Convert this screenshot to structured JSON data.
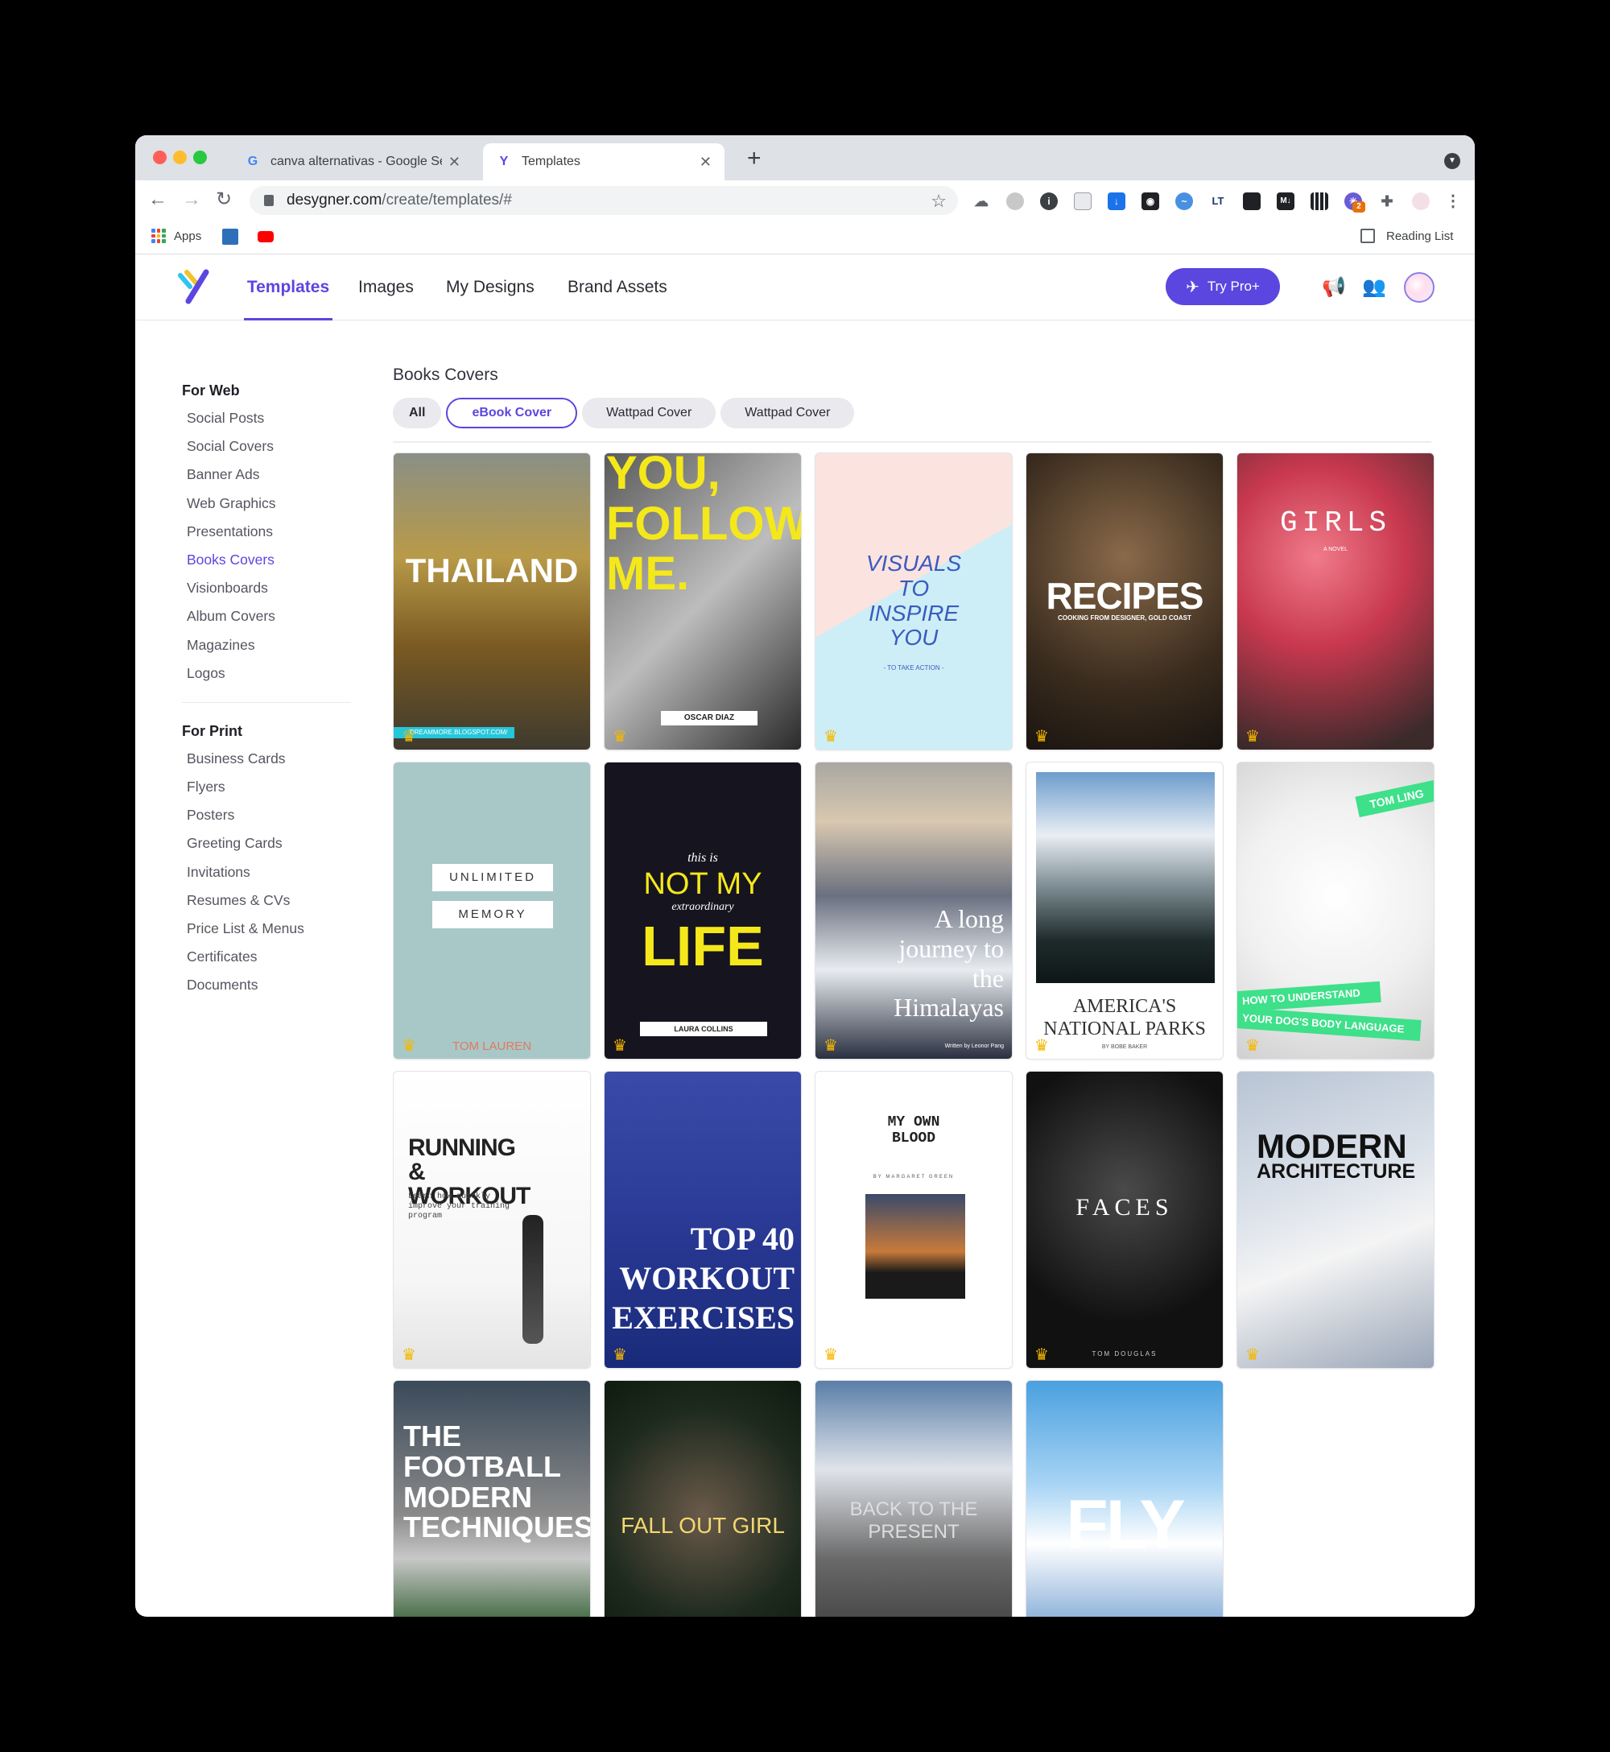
{
  "browser": {
    "tabs": [
      {
        "title": "canva alternativas - Google Se",
        "favicon": "google-icon"
      },
      {
        "title": "Templates",
        "favicon": "desygner-icon"
      }
    ],
    "url_domain": "desygner.com",
    "url_path": "/create/templates/#",
    "bookmarks": {
      "apps_label": "Apps",
      "reading_list_label": "Reading List"
    },
    "extension_badge": "2"
  },
  "app": {
    "nav": [
      "Templates",
      "Images",
      "My Designs",
      "Brand Assets"
    ],
    "active_nav": "Templates",
    "try_pro_label": "Try Pro+",
    "accent": "#5b46e0"
  },
  "sidebar": {
    "web_heading": "For Web",
    "web_items": [
      "Social Posts",
      "Social Covers",
      "Banner Ads",
      "Web Graphics",
      "Presentations",
      "Books Covers",
      "Visionboards",
      "Album Covers",
      "Magazines",
      "Logos"
    ],
    "print_heading": "For Print",
    "print_items": [
      "Business Cards",
      "Flyers",
      "Posters",
      "Greeting Cards",
      "Invitations",
      "Resumes & CVs",
      "Price List & Menus",
      "Certificates",
      "Documents"
    ],
    "active_item": "Books Covers"
  },
  "main": {
    "title": "Books Covers",
    "filters": [
      "All",
      "eBook Cover",
      "Wattpad Cover",
      "Wattpad Cover"
    ],
    "selected_filter": "eBook Cover"
  },
  "templates": [
    {
      "title": "THAILAND",
      "sub": "DREAMMORE.BLOGSPOT.COM/"
    },
    {
      "title": "YOU, FOLLOW ME.",
      "sub": "OSCAR DIAZ"
    },
    {
      "title": "VISUALS TO INSPIRE YOU",
      "sub": "- TO TAKE ACTION -"
    },
    {
      "title": "RECIPES",
      "sub": "COOKING FROM DESIGNER, GOLD COAST"
    },
    {
      "title": "GIRLS",
      "sub": "A NOVEL"
    },
    {
      "title": "UNLIMITED",
      "title2": "MEMORY",
      "sub": "TOM LAUREN"
    },
    {
      "title": "this is",
      "title2": "NOT MY",
      "title3": "extraordinary",
      "title4": "LIFE",
      "sub": "LAURA COLLINS"
    },
    {
      "title": "A long journey to the Himalayas",
      "sub": "Written by Leonor Pang"
    },
    {
      "title": "AMERICA'S",
      "title2": "NATIONAL PARKS",
      "sub": "BY BOBE BAKER"
    },
    {
      "title": "TOM LING",
      "title2": "HOW TO UNDERSTAND",
      "title3": "YOUR DOG'S BODY LANGUAGE"
    },
    {
      "title": "RUNNING & WORKOUT",
      "sub": "Learn how quickly improve your training program"
    },
    {
      "title": "TOP 40 WORKOUT EXERCISES"
    },
    {
      "title": "MY OWN BLOOD",
      "sub": "BY MARGARET GREEN"
    },
    {
      "title": "FACES",
      "sub": "TOM DOUGLAS"
    },
    {
      "title": "MODERN",
      "title2": "ARCHITECTURE"
    },
    {
      "title": "THE FOOTBALL MODERN TECHNIQUES"
    },
    {
      "title": "FALL OUT GIRL"
    },
    {
      "title": "BACK TO THE PRESENT"
    },
    {
      "title": "FLY"
    }
  ]
}
